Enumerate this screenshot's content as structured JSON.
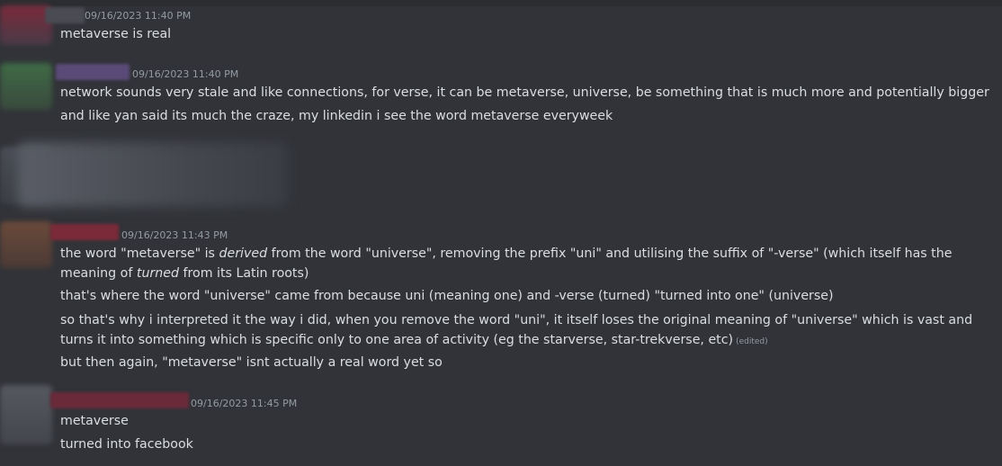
{
  "colors": {
    "background": "#313338",
    "text": "#dbdee1",
    "muted": "#949ba4"
  },
  "messages": [
    {
      "timestamp": "09/16/2023 11:40 PM",
      "lines": [
        "metaverse is real"
      ]
    },
    {
      "timestamp": "09/16/2023 11:40 PM",
      "lines": [
        "network sounds very stale and like connections, for verse, it can be metaverse, universe, be something that is much more and potentially bigger",
        "and like yan said its much the craze, my linkedin i see the word metaverse everyweek"
      ]
    },
    {
      "timestamp": "09/16/2023 11:43 PM",
      "line1": {
        "a": "the word \"metaverse\" is ",
        "b": "derived",
        "c": " from the word \"universe\", removing the prefix \"uni\" and utilising the suffix of \"-verse\" (which itself has the meaning of ",
        "d": "turned",
        "e": " from its Latin roots)"
      },
      "line2": "that's where the word \"universe\" came from because uni (meaning one) and -verse (turned) \"turned into one\" (universe)",
      "line3": "so that's why i interpreted it the way i did, when you remove the word \"uni\", it itself loses the original meaning of \"universe\" which is vast and turns it into something which is specific only to one area of activity (eg the starverse, star-trekverse, etc)",
      "line3_edited": "(edited)",
      "line4": "but then again, \"metaverse\" isnt actually a real word yet so"
    },
    {
      "timestamp": "09/16/2023 11:45 PM",
      "lines": [
        "metaverse",
        "turned into facebook"
      ]
    }
  ]
}
